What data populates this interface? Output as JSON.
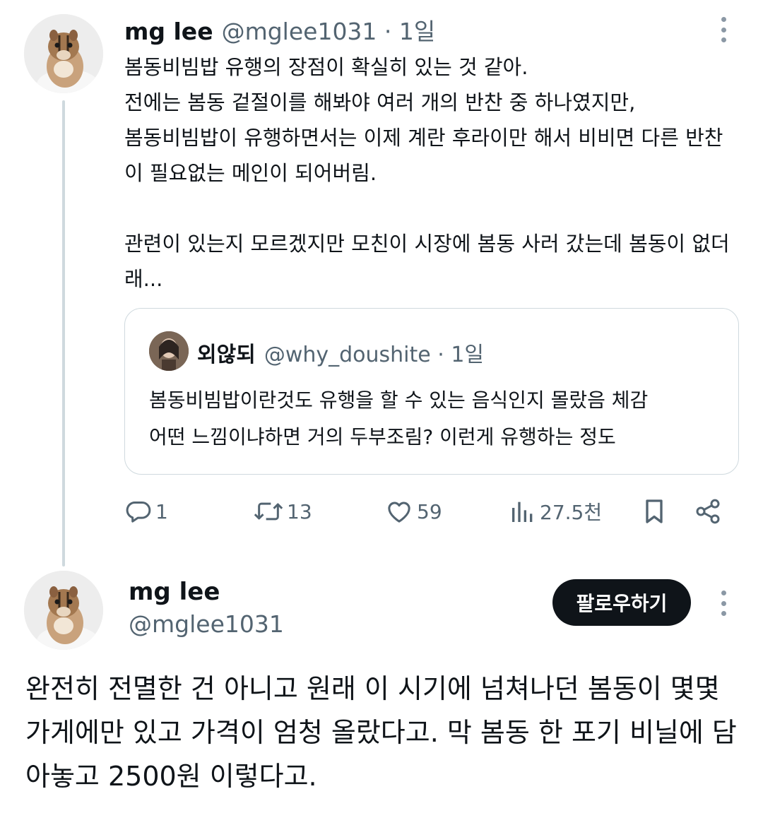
{
  "tweet1": {
    "name": "mg lee",
    "handle": "@mglee1031",
    "time": "1일",
    "meta": "@mglee1031 · 1일",
    "body": "봄동비빔밥 유행의 장점이 확실히 있는 것 같아.\n전에는 봄동 겉절이를 해봐야 여러 개의 반찬 중 하나였지만,\n봄동비빔밥이 유행하면서는 이제 계란 후라이만 해서 비비면 다른 반찬이 필요없는 메인이 되어버림.\n\n관련이 있는지 모르겠지만 모친이 시장에 봄동 사러 갔는데 봄동이 없더래...",
    "avatar_icon": "chipmunk-avatar"
  },
  "quote": {
    "name": "외않되",
    "handle": "@why_doushite",
    "time": "1일",
    "meta": "@why_doushite · 1일",
    "body": "봄동비빔밥이란것도 유행을 할 수 있는 음식인지 몰랐음 체감\n어떤 느낌이냐하면 거의 두부조림? 이런게 유행하는 정도"
  },
  "actions": {
    "reply_count": "1",
    "retweet_count": "13",
    "like_count": "59",
    "view_count": "27.5천"
  },
  "tweet2": {
    "name": "mg lee",
    "handle": "@mglee1031",
    "follow_label": "팔로우하기",
    "body": "완전히 전멸한 건 아니고 원래 이 시기에 넘쳐나던 봄동이 몇몇 가게에만 있고 가격이 엄청 올랐다고. 막 봄동 한 포기 비닐에 담아놓고 2500원 이렇다고."
  },
  "colors": {
    "text": "#0f1419",
    "secondary": "#536471",
    "border": "#cfd9de",
    "button_bg": "#0f1419"
  }
}
